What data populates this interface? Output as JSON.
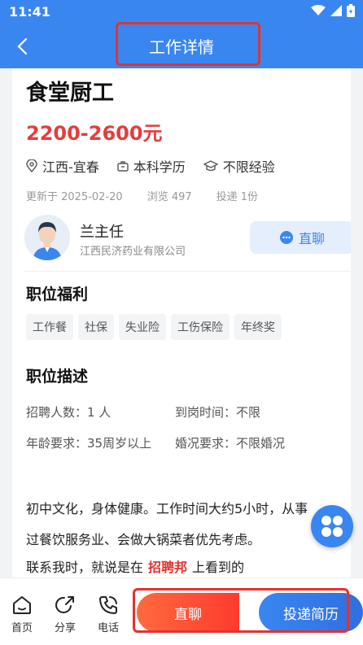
{
  "status_bar": {
    "time": "11:41"
  },
  "header": {
    "title": "工作详情"
  },
  "job": {
    "title": "食堂厨工",
    "salary": "2200-2600元",
    "location": "江西-宜春",
    "education": "本科学历",
    "experience": "不限经验",
    "updated": "更新于 2025-02-20",
    "views": "浏览 497",
    "applications": "投递 1份"
  },
  "recruiter": {
    "name": "兰主任",
    "company": "江西民济药业有限公司",
    "chat_label": "直聊"
  },
  "benefits": {
    "title": "职位福利",
    "tags": [
      "工作餐",
      "社保",
      "失业险",
      "工伤保险",
      "年终奖"
    ]
  },
  "description": {
    "title": "职位描述",
    "headcount": "招聘人数：1 人",
    "start_time": "到岗时间：不限",
    "age": "年龄要求：35周岁以上",
    "marital": "婚况要求：不限婚况",
    "line1": "初中文化，身体健康。工作时间大约5小时，从事",
    "line2": "过餐饮服务业、会做大锅菜者优先考虑。",
    "contact_prefix": "联系我时，就说是在",
    "contact_brand": "招聘邦",
    "contact_suffix": "上看到的"
  },
  "bottom_bar": {
    "home": "首页",
    "share": "分享",
    "phone": "电话",
    "chat_button": "直聊",
    "apply_button": "投递简历"
  },
  "colors": {
    "primary": "#3a86f0",
    "salary": "#e43d3d",
    "highlight": "#e4322f"
  }
}
